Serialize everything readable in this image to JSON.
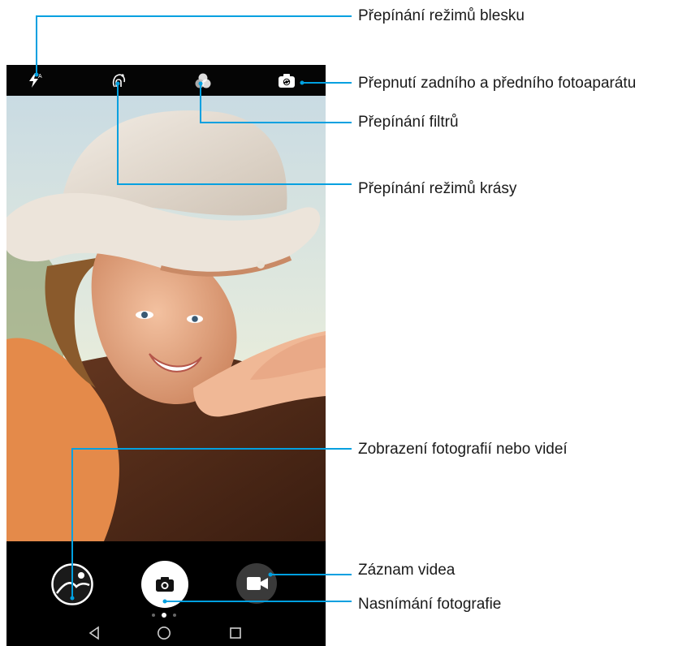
{
  "callouts": {
    "flash": "Přepínání režimů blesku",
    "switch_camera": "Přepnutí zadního a předního fotoaparátu",
    "filters": "Přepínání filtrů",
    "beauty": "Přepínání režimů krásy",
    "gallery": "Zobrazení fotografií nebo videí",
    "video": "Záznam videa",
    "shutter": "Nasnímání fotografie"
  },
  "top_bar_icons": [
    "flash-auto-icon",
    "beauty-mode-icon",
    "filter-icon",
    "switch-camera-icon"
  ],
  "bottom_icons": [
    "gallery-thumbnail-icon",
    "camera-icon",
    "video-camera-icon"
  ],
  "nav_icons": [
    "back-triangle-icon",
    "home-circle-icon",
    "recents-square-icon"
  ],
  "colors": {
    "accent_line": "#00A0E0",
    "bar_background": "#000000",
    "shutter_button": "#FFFFFF",
    "video_button": "#3A3A3A"
  }
}
